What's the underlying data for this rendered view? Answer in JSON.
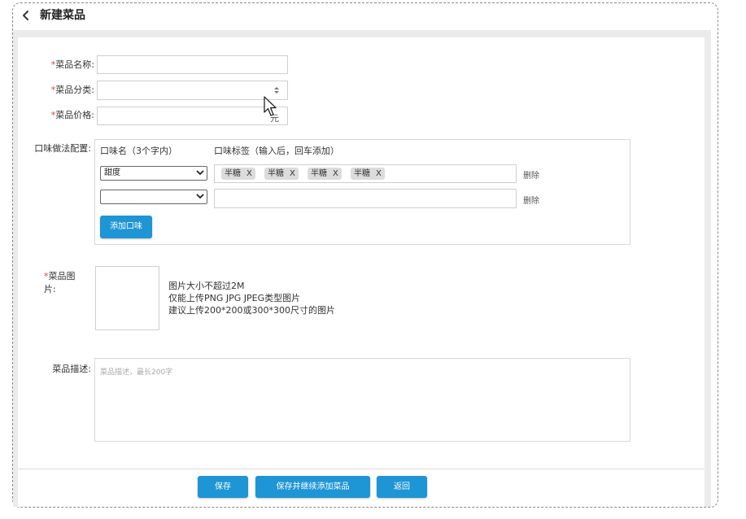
{
  "header": {
    "title": "新建菜品"
  },
  "form": {
    "name": {
      "required_mark": "*",
      "label": "菜品名称:",
      "value": "",
      "placeholder": ""
    },
    "category": {
      "required_mark": "*",
      "label": "菜品分类:",
      "value": ""
    },
    "price": {
      "required_mark": "*",
      "label": "菜品价格:",
      "value": "",
      "unit": "元"
    },
    "flavor": {
      "label": "口味做法配置:",
      "col_name": "口味名（3个字内）",
      "col_tags": "口味标签（输入后，回车添加）",
      "rows": [
        {
          "selected": "甜度",
          "tags": [
            "半糖",
            "半糖",
            "半糖",
            "半糖"
          ],
          "delete": "删除"
        },
        {
          "selected": "",
          "tags": [],
          "delete": "删除"
        }
      ],
      "tag_remove": "X",
      "add_button": "添加口味"
    },
    "image": {
      "required_mark": "*",
      "label_line1": "菜品图",
      "label_line2": "片:",
      "hints": [
        "图片大小不超过2M",
        "仅能上传PNG JPG JPEG类型图片",
        "建议上传200*200或300*300尺寸的图片"
      ]
    },
    "description": {
      "label": "菜品描述:",
      "placeholder": "菜品描述，最长200字",
      "value": ""
    }
  },
  "footer": {
    "save": "保存",
    "save_continue": "保存并继续添加菜品",
    "back": "返回"
  },
  "colors": {
    "primary": "#1e95d4",
    "required": "#e23b3b",
    "tag_bg": "#dcdcdc"
  },
  "icons": {
    "back": "chevron-left-icon",
    "sort": "sort-arrows-icon",
    "dropdown": "chevron-down-icon",
    "cursor": "mouse-pointer-icon"
  }
}
